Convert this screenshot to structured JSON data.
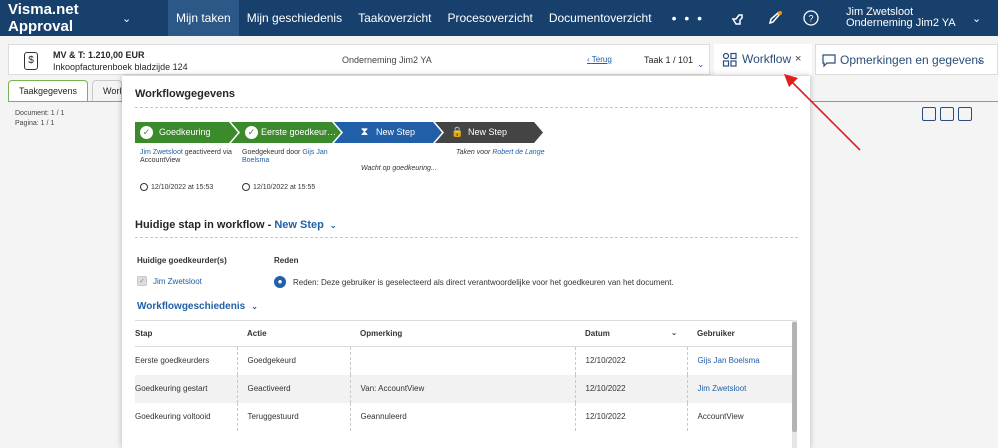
{
  "app": {
    "brand": "Visma.net Approval"
  },
  "nav": {
    "items": [
      "Mijn taken",
      "Mijn geschiedenis",
      "Taakoverzicht",
      "Procesoverzicht",
      "Documentoverzicht"
    ],
    "more": "• • •"
  },
  "user": {
    "name": "Jim Zwetsloot",
    "company": "Onderneming Jim2 YA"
  },
  "doc": {
    "title": "MV & T: 1.210,00 EUR",
    "subtitle": "Inkoopfacturenboek bladzijde 124",
    "company": "Onderneming Jim2 YA",
    "back": "Terug",
    "task": "Taak 1 / 101"
  },
  "workflow_button": {
    "label": "Workflow",
    "close": "×"
  },
  "remarks_button": {
    "label": "Opmerkingen en gegevens"
  },
  "tabs": {
    "active": "Taakgegevens",
    "inactive": "Work"
  },
  "left_info": {
    "document": "Document: 1 / 1",
    "page": "Pagina: 1 / 1"
  },
  "panel": {
    "title": "Workflowgegevens",
    "steps": [
      {
        "label": "Goedkeuring gestart",
        "info_user": "Jim Zwetsloot",
        "info_text": "geactiveerd via AccountView",
        "date": "12/10/2022 at 15:53"
      },
      {
        "label": "Eerste goedkeur…",
        "info_text": "Goedgekeurd door",
        "info_user": "Gijs Jan Boelsma",
        "date": "12/10/2022 at 15:55"
      },
      {
        "label": "New Step",
        "info_text": "Wacht op goedkeuring..."
      },
      {
        "label": "New Step",
        "info_text": "Taken voor",
        "info_user": "Robert de Lange"
      }
    ],
    "current_step_label": "Huidige stap in workflow -",
    "current_step_value": "New Step",
    "approvers_label": "Huidige goedkeurder(s)",
    "reason_label": "Reden",
    "approver": "Jim Zwetsloot",
    "reason_text": "Reden: Deze gebruiker is geselecteerd als direct verantwoordelijke voor het goedkeuren van het document.",
    "history_title": "Workflowgeschiedenis",
    "history_columns": [
      "Stap",
      "Actie",
      "Opmerking",
      "Datum",
      "Gebruiker"
    ],
    "history_rows": [
      [
        "Eerste goedkeurders",
        "Goedgekeurd",
        "",
        "12/10/2022",
        "Gijs Jan Boelsma"
      ],
      [
        "Goedkeuring gestart",
        "Geactiveerd",
        "Van: AccountView",
        "12/10/2022",
        "Jim Zwetsloot"
      ],
      [
        "Goedkeuring voltooid",
        "Teruggestuurd",
        "Geannuleerd",
        "12/10/2022",
        "AccountView"
      ]
    ]
  },
  "colors": {
    "topbar": "#17406d",
    "accent": "#2160a8",
    "green": "#3b8a2c",
    "arrow": "#e11f1f"
  }
}
